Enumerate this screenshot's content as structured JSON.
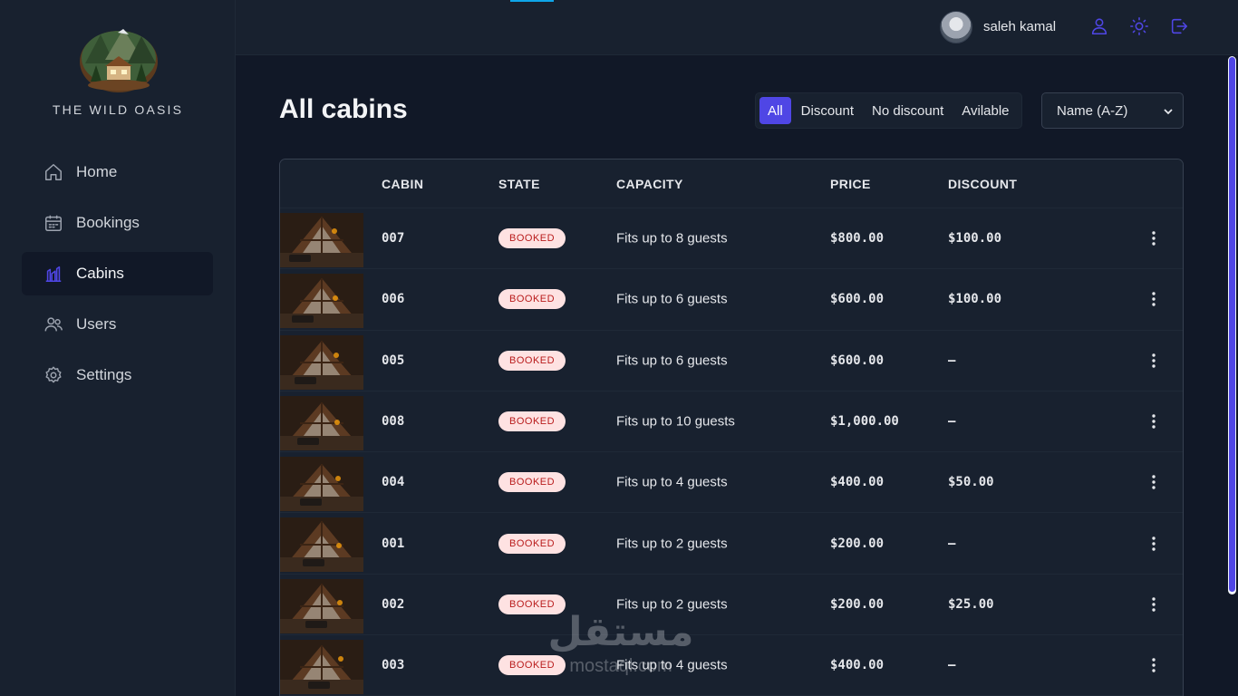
{
  "sidebar": {
    "brand": "THE WILD OASIS",
    "items": [
      {
        "label": "Home",
        "icon": "home-icon"
      },
      {
        "label": "Bookings",
        "icon": "calendar-icon"
      },
      {
        "label": "Cabins",
        "icon": "cabins-chart-icon",
        "active": true
      },
      {
        "label": "Users",
        "icon": "users-icon"
      },
      {
        "label": "Settings",
        "icon": "settings-icon"
      }
    ]
  },
  "header": {
    "username": "saleh kamal",
    "actions": [
      "user-icon",
      "sun-icon",
      "logout-icon"
    ]
  },
  "main": {
    "title": "All cabins",
    "filter": {
      "options": [
        "All",
        "Discount",
        "No discount",
        "Avilable"
      ],
      "active": "All"
    },
    "sort": {
      "selected": "Name (A-Z)"
    },
    "table": {
      "headers": [
        "CABIN",
        "STATE",
        "CAPACITY",
        "PRICE",
        "DISCOUNT"
      ],
      "rows": [
        {
          "cabin": "007",
          "state": "BOOKED",
          "capacity": "Fits up to 8 guests",
          "price": "$800.00",
          "discount": "$100.00"
        },
        {
          "cabin": "006",
          "state": "BOOKED",
          "capacity": "Fits up to 6 guests",
          "price": "$600.00",
          "discount": "$100.00"
        },
        {
          "cabin": "005",
          "state": "BOOKED",
          "capacity": "Fits up to 6 guests",
          "price": "$600.00",
          "discount": "—"
        },
        {
          "cabin": "008",
          "state": "BOOKED",
          "capacity": "Fits up to 10 guests",
          "price": "$1,000.00",
          "discount": "—"
        },
        {
          "cabin": "004",
          "state": "BOOKED",
          "capacity": "Fits up to 4 guests",
          "price": "$400.00",
          "discount": "$50.00"
        },
        {
          "cabin": "001",
          "state": "BOOKED",
          "capacity": "Fits up to 2 guests",
          "price": "$200.00",
          "discount": "—"
        },
        {
          "cabin": "002",
          "state": "BOOKED",
          "capacity": "Fits up to 2 guests",
          "price": "$200.00",
          "discount": "$25.00"
        },
        {
          "cabin": "003",
          "state": "BOOKED",
          "capacity": "Fits up to 4 guests",
          "price": "$400.00",
          "discount": "—"
        }
      ]
    }
  },
  "watermark": {
    "arabic": "مستقل",
    "latin": "mostaql.com"
  },
  "colors": {
    "background": "#111827",
    "panel": "#18212f",
    "accent": "#4f46e5",
    "badge_bg": "#fee2e2",
    "badge_text": "#b91c1c"
  }
}
